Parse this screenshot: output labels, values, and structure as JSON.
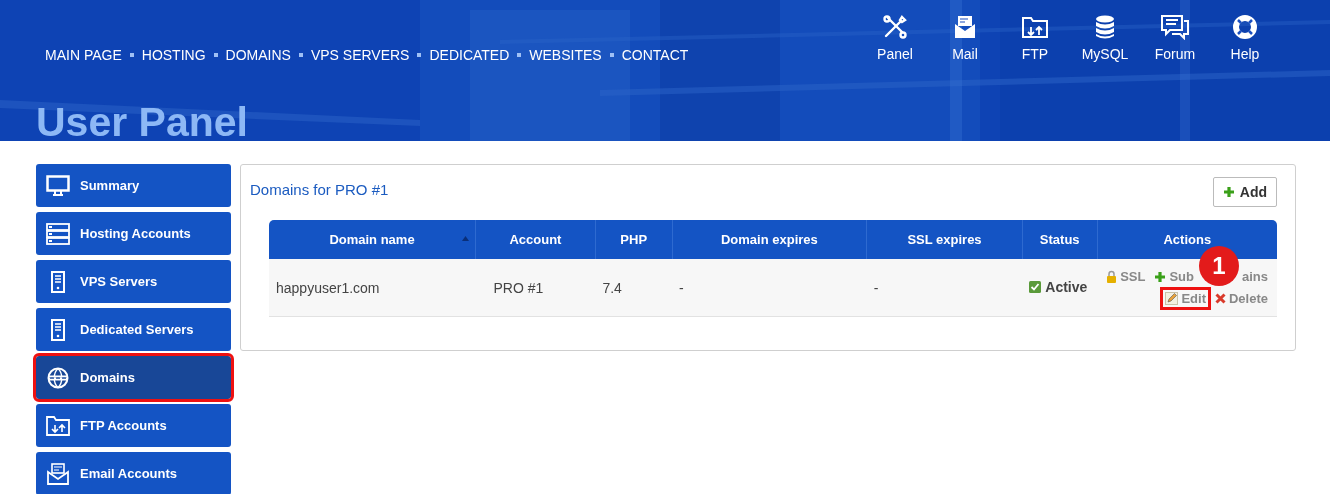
{
  "nav": {
    "links": [
      "MAIN PAGE",
      "HOSTING",
      "DOMAINS",
      "VPS SERVERS",
      "DEDICATED",
      "WEBSITES",
      "CONTACT"
    ]
  },
  "tools": [
    {
      "kind": "panel",
      "label": "Panel"
    },
    {
      "kind": "mail",
      "label": "Mail"
    },
    {
      "kind": "ftp",
      "label": "FTP"
    },
    {
      "kind": "database",
      "label": "MySQL"
    },
    {
      "kind": "forum",
      "label": "Forum"
    },
    {
      "kind": "help",
      "label": "Help"
    }
  ],
  "page_title": "User Panel",
  "sidebar": {
    "items": [
      {
        "kind": "monitor",
        "label": "Summary",
        "selected": false
      },
      {
        "kind": "rack",
        "label": "Hosting Accounts",
        "selected": false
      },
      {
        "kind": "server",
        "label": "VPS Servers",
        "selected": false
      },
      {
        "kind": "server",
        "label": "Dedicated Servers",
        "selected": false
      },
      {
        "kind": "www",
        "label": "Domains",
        "selected": true
      },
      {
        "kind": "ftp",
        "label": "FTP Accounts",
        "selected": false
      },
      {
        "kind": "mail",
        "label": "Email Accounts",
        "selected": false
      }
    ]
  },
  "panel": {
    "title": "Domains for PRO #1",
    "add_button": "Add",
    "table": {
      "columns": [
        {
          "label": "Domain name",
          "sorted": true
        },
        {
          "label": "Account",
          "sorted": false
        },
        {
          "label": "PHP",
          "sorted": false
        },
        {
          "label": "Domain expires",
          "sorted": false
        },
        {
          "label": "SSL expires",
          "sorted": false
        },
        {
          "label": "Status",
          "sorted": false
        },
        {
          "label": "Actions",
          "sorted": false
        }
      ],
      "rows": [
        {
          "domain": "happyuser1.com",
          "account": "PRO #1",
          "php": "7.4",
          "domain_expires": "-",
          "ssl_expires": "-",
          "status": "Active",
          "actions": [
            {
              "kind": "ssl",
              "label": "SSL",
              "highlighted": false
            },
            {
              "kind": "subdomains",
              "label": "Sub",
              "label_after_badge": "ains",
              "highlighted": false
            },
            {
              "kind": "edit",
              "label": "Edit",
              "highlighted": true
            },
            {
              "kind": "delete",
              "label": "Delete",
              "highlighted": false
            }
          ]
        }
      ]
    }
  },
  "annotation": {
    "badge": "1"
  }
}
